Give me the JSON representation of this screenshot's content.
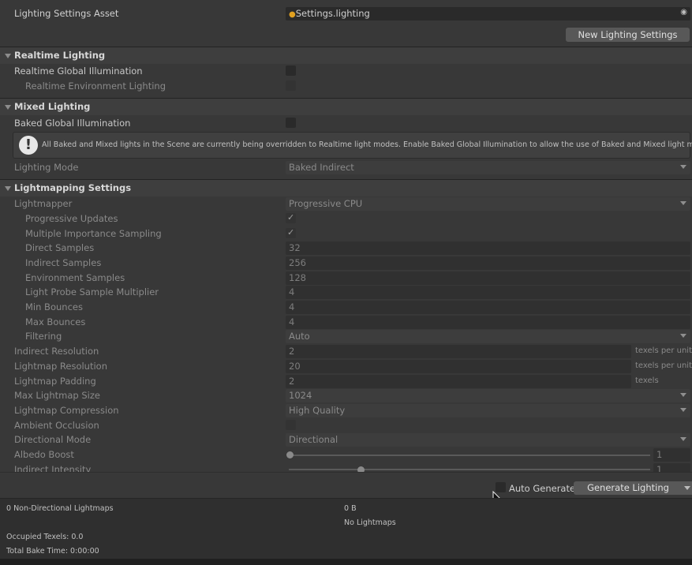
{
  "top": {
    "asset_label": "Lighting Settings Asset",
    "asset_value": "Settings.lighting",
    "new_button": "New Lighting Settings"
  },
  "realtime": {
    "title": "Realtime Lighting",
    "gi_label": "Realtime Global Illumination",
    "env_label": "Realtime Environment Lighting"
  },
  "mixed": {
    "title": "Mixed Lighting",
    "baked_label": "Baked Global Illumination",
    "warning": "All Baked and Mixed lights in the Scene are currently being overridden to Realtime light modes. Enable Baked Global Illumination to allow the use of Baked and Mixed light modes.",
    "mode_label": "Lighting Mode",
    "mode_value": "Baked Indirect"
  },
  "lightmapping": {
    "title": "Lightmapping Settings",
    "lightmapper_label": "Lightmapper",
    "lightmapper_value": "Progressive CPU",
    "progressive_label": "Progressive Updates",
    "mis_label": "Multiple Importance Sampling",
    "direct_label": "Direct Samples",
    "direct_value": "32",
    "indirect_label": "Indirect Samples",
    "indirect_value": "256",
    "env_label": "Environment Samples",
    "env_value": "128",
    "probe_label": "Light Probe Sample Multiplier",
    "probe_value": "4",
    "minb_label": "Min Bounces",
    "minb_value": "4",
    "maxb_label": "Max Bounces",
    "maxb_value": "4",
    "filter_label": "Filtering",
    "filter_value": "Auto",
    "indres_label": "Indirect Resolution",
    "indres_value": "2",
    "indres_unit": "texels per unit",
    "lmres_label": "Lightmap Resolution",
    "lmres_value": "20",
    "lmres_unit": "texels per unit",
    "pad_label": "Lightmap Padding",
    "pad_value": "2",
    "pad_unit": "texels",
    "maxsize_label": "Max Lightmap Size",
    "maxsize_value": "1024",
    "comp_label": "Lightmap Compression",
    "comp_value": "High Quality",
    "ao_label": "Ambient Occlusion",
    "dirmode_label": "Directional Mode",
    "dirmode_value": "Directional",
    "albedo_label": "Albedo Boost",
    "albedo_value": "1",
    "intensity_label": "Indirect Intensity",
    "intensity_value": "1"
  },
  "bottom": {
    "auto_label": "Auto Generate",
    "generate_button": "Generate Lighting",
    "nondir": "0 Non-Directional Lightmaps",
    "size": "0 B",
    "no_lightmaps": "No Lightmaps",
    "occupied": "Occupied Texels: 0.0",
    "bake_time": "Total Bake Time: 0:00:00"
  },
  "colors": {
    "accent_icon": "#e0a020",
    "warning_icon_bg": "#e8e8e8"
  }
}
